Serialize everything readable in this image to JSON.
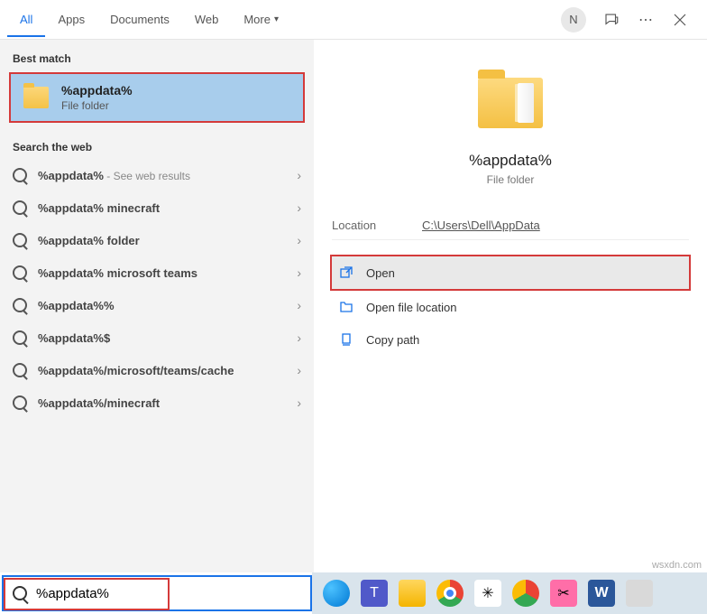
{
  "tabs": {
    "all": "All",
    "apps": "Apps",
    "documents": "Documents",
    "web": "Web",
    "more": "More"
  },
  "avatar_initial": "N",
  "sections": {
    "best": "Best match",
    "web": "Search the web"
  },
  "best_match": {
    "title": "%appdata%",
    "subtitle": "File folder"
  },
  "web_results": [
    {
      "text": "%appdata%",
      "sub": " - See web results"
    },
    {
      "text": "%appdata% minecraft",
      "sub": ""
    },
    {
      "text": "%appdata% folder",
      "sub": ""
    },
    {
      "text": "%appdata% microsoft teams",
      "sub": ""
    },
    {
      "text": "%appdata%%",
      "sub": ""
    },
    {
      "text": "%appdata%$",
      "sub": ""
    },
    {
      "text": "%appdata%/microsoft/teams/cache",
      "sub": ""
    },
    {
      "text": "%appdata%/minecraft",
      "sub": ""
    }
  ],
  "preview": {
    "title": "%appdata%",
    "subtitle": "File folder",
    "location_label": "Location",
    "location_value": "C:\\Users\\Dell\\AppData",
    "actions": {
      "open": "Open",
      "open_loc": "Open file location",
      "copy": "Copy path"
    }
  },
  "search_value": "%appdata%",
  "watermark": "wsxdn.com"
}
